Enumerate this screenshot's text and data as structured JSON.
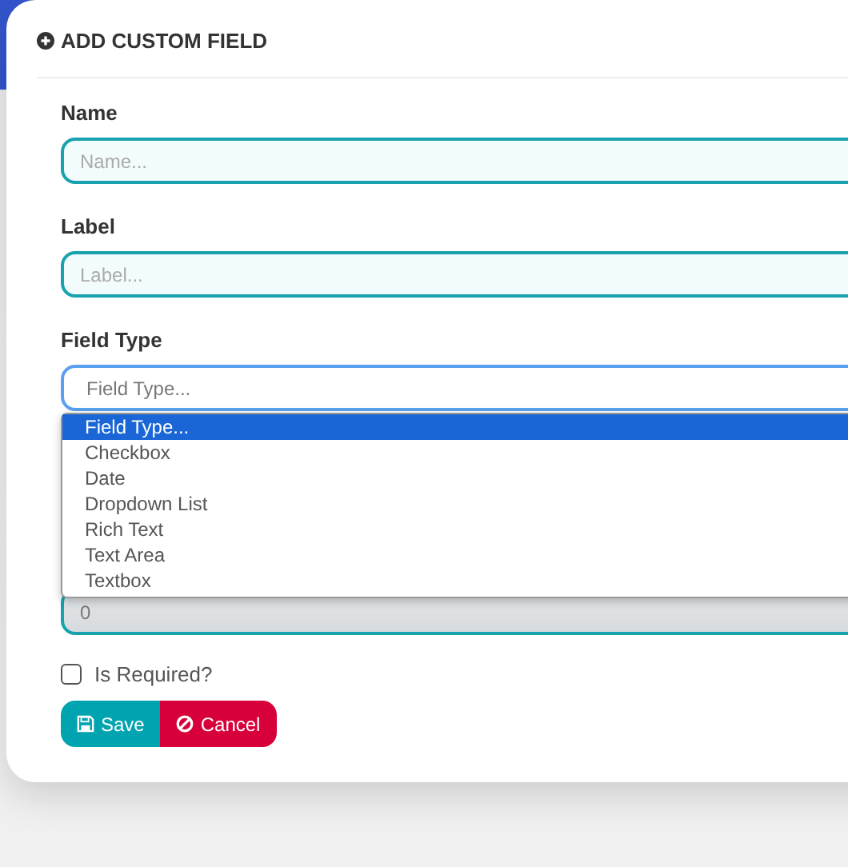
{
  "title": "ADD CUSTOM FIELD",
  "fields": [
    {
      "label": "Name",
      "placeholder": "Name..."
    },
    {
      "label": "Label",
      "placeholder": "Label..."
    }
  ],
  "field_type": {
    "label": "Field Type",
    "placeholder": "Field Type...",
    "expanded": true,
    "options": [
      {
        "label": "Field Type...",
        "selected": true
      },
      {
        "label": "Checkbox",
        "selected": false
      },
      {
        "label": "Date",
        "selected": false
      },
      {
        "label": "Dropdown List",
        "selected": false
      },
      {
        "label": "Rich Text",
        "selected": false
      },
      {
        "label": "Text Area",
        "selected": false
      },
      {
        "label": "Textbox",
        "selected": false
      }
    ]
  },
  "number_field": {
    "value": "0",
    "disabled": true
  },
  "required": {
    "label": "Is Required?",
    "checked": false
  },
  "buttons": [
    {
      "label": "Save",
      "kind": "save"
    },
    {
      "label": "Cancel",
      "kind": "cancel"
    }
  ]
}
